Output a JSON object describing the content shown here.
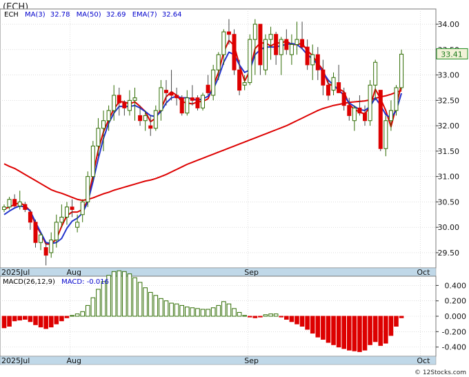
{
  "window_title": "(ECH)",
  "watermark": "© 12Stocks.com",
  "colors": {
    "up": "#2e6b00",
    "down": "#dd0000",
    "ma_short": "#dd0000",
    "ma_long": "#0000cc",
    "ema": "#2233cc",
    "band": "#c0d8e8",
    "grid": "#c8c8c8",
    "price_box_bg": "#f2f2d8",
    "price_box_border": "#1a8a1a"
  },
  "chart_data": [
    {
      "type": "candlestick",
      "ticker": "ECH",
      "legend": [
        {
          "label": "ECH",
          "value": "",
          "color": "#000000"
        },
        {
          "label": "MA(3)",
          "value": "32.78",
          "color": "#dd0000"
        },
        {
          "label": "MA(50)",
          "value": "32.69",
          "color": "#0000cc"
        },
        {
          "label": "EMA(7)",
          "value": "32.64",
          "color": "#2233cc"
        }
      ],
      "last_price": "33.41",
      "ylim": [
        29.2,
        34.3
      ],
      "y_ticks": [
        "29.50",
        "30.00",
        "30.50",
        "31.00",
        "31.50",
        "32.00",
        "32.50",
        "33.00",
        "33.50",
        "34.00"
      ],
      "x_labels": [
        "2025Jul",
        "Aug",
        "Sep",
        "Oct"
      ],
      "x_label_index": [
        0,
        13,
        47,
        80
      ],
      "candles": [
        [
          30.35,
          30.45,
          30.3,
          30.4
        ],
        [
          30.4,
          30.6,
          30.35,
          30.55
        ],
        [
          30.55,
          30.65,
          30.4,
          30.42
        ],
        [
          30.42,
          30.72,
          30.35,
          30.5
        ],
        [
          30.45,
          30.5,
          30.3,
          30.35
        ],
        [
          30.3,
          30.35,
          29.95,
          30.1
        ],
        [
          30.1,
          30.15,
          29.6,
          29.7
        ],
        [
          29.7,
          29.9,
          29.55,
          29.85
        ],
        [
          29.6,
          29.7,
          29.25,
          29.45
        ],
        [
          29.5,
          29.9,
          29.4,
          29.75
        ],
        [
          29.75,
          30.25,
          29.6,
          30.1
        ],
        [
          30.1,
          30.45,
          30.0,
          30.2
        ],
        [
          30.2,
          30.5,
          30.05,
          30.4
        ],
        [
          30.4,
          30.55,
          30.2,
          30.35
        ],
        [
          30.0,
          30.25,
          29.9,
          30.1
        ],
        [
          30.25,
          30.55,
          30.1,
          30.5
        ],
        [
          30.5,
          31.1,
          30.4,
          31.0
        ],
        [
          31.0,
          31.7,
          30.9,
          31.6
        ],
        [
          31.6,
          32.15,
          31.4,
          31.95
        ],
        [
          31.95,
          32.3,
          31.5,
          32.1
        ],
        [
          32.1,
          32.4,
          31.9,
          32.3
        ],
        [
          32.3,
          32.8,
          32.1,
          32.6
        ],
        [
          32.6,
          32.75,
          32.2,
          32.45
        ],
        [
          32.45,
          32.5,
          32.2,
          32.35
        ],
        [
          32.3,
          32.7,
          32.2,
          32.5
        ],
        [
          32.5,
          32.75,
          32.1,
          32.55
        ],
        [
          32.2,
          32.4,
          32.0,
          32.1
        ],
        [
          32.1,
          32.3,
          31.9,
          32.2
        ],
        [
          32.0,
          32.2,
          31.8,
          31.95
        ],
        [
          31.95,
          32.4,
          31.9,
          32.3
        ],
        [
          32.3,
          32.9,
          32.1,
          32.75
        ],
        [
          32.7,
          32.9,
          32.4,
          32.65
        ],
        [
          32.65,
          33.1,
          32.5,
          32.6
        ],
        [
          32.6,
          32.75,
          32.4,
          32.55
        ],
        [
          32.55,
          32.6,
          32.2,
          32.25
        ],
        [
          32.25,
          32.7,
          32.2,
          32.55
        ],
        [
          32.55,
          32.8,
          32.4,
          32.5
        ],
        [
          32.55,
          32.6,
          32.3,
          32.35
        ],
        [
          32.35,
          32.65,
          32.3,
          32.6
        ],
        [
          32.8,
          33.0,
          32.6,
          32.65
        ],
        [
          32.6,
          33.2,
          32.5,
          33.1
        ],
        [
          33.1,
          33.45,
          32.9,
          33.4
        ],
        [
          33.4,
          33.9,
          33.2,
          33.85
        ],
        [
          33.85,
          34.1,
          33.6,
          33.8
        ],
        [
          33.8,
          33.9,
          33.0,
          33.1
        ],
        [
          33.1,
          33.3,
          32.6,
          32.7
        ],
        [
          32.8,
          33.0,
          32.7,
          32.85
        ],
        [
          32.85,
          33.8,
          32.8,
          33.7
        ],
        [
          33.7,
          34.1,
          33.0,
          34.0
        ],
        [
          34.0,
          34.0,
          33.0,
          33.2
        ],
        [
          33.1,
          33.8,
          33.0,
          33.7
        ],
        [
          33.7,
          33.95,
          33.3,
          33.8
        ],
        [
          33.8,
          33.85,
          33.2,
          33.4
        ],
        [
          33.4,
          33.75,
          33.0,
          33.7
        ],
        [
          33.7,
          33.9,
          33.4,
          33.5
        ],
        [
          33.4,
          33.8,
          33.2,
          33.6
        ],
        [
          33.6,
          34.05,
          33.4,
          33.7
        ],
        [
          33.7,
          34.05,
          33.5,
          33.55
        ],
        [
          33.55,
          33.7,
          33.1,
          33.2
        ],
        [
          33.2,
          33.6,
          32.9,
          33.4
        ],
        [
          33.4,
          33.55,
          32.9,
          33.1
        ],
        [
          33.1,
          33.3,
          32.6,
          32.8
        ],
        [
          32.8,
          32.9,
          32.5,
          32.6
        ],
        [
          32.7,
          33.05,
          32.6,
          32.95
        ],
        [
          32.85,
          33.2,
          32.7,
          32.65
        ],
        [
          32.65,
          32.75,
          32.3,
          32.4
        ],
        [
          32.4,
          32.55,
          32.1,
          32.2
        ],
        [
          32.1,
          32.4,
          31.9,
          32.35
        ],
        [
          32.35,
          32.6,
          32.2,
          32.25
        ],
        [
          32.25,
          32.4,
          32.0,
          32.1
        ],
        [
          32.1,
          32.9,
          32.0,
          32.8
        ],
        [
          32.8,
          33.3,
          32.5,
          33.25
        ],
        [
          32.7,
          32.7,
          31.5,
          31.55
        ],
        [
          31.55,
          32.2,
          31.4,
          32.1
        ],
        [
          32.1,
          32.5,
          31.9,
          32.3
        ],
        [
          32.3,
          32.8,
          32.2,
          32.75
        ],
        [
          32.75,
          33.5,
          32.7,
          33.41
        ]
      ],
      "ma_fast": [
        30.36,
        30.4,
        30.45,
        30.48,
        30.43,
        30.32,
        30.05,
        29.88,
        29.67,
        29.67,
        29.77,
        30.02,
        30.23,
        30.3,
        30.3,
        30.35,
        30.53,
        31.03,
        31.52,
        31.88,
        32.12,
        32.33,
        32.47,
        32.47,
        32.43,
        32.47,
        32.38,
        32.28,
        32.08,
        32.15,
        32.33,
        32.57,
        32.67,
        32.6,
        32.47,
        32.45,
        32.43,
        32.47,
        32.48,
        32.53,
        32.78,
        33.05,
        33.45,
        33.68,
        33.58,
        33.2,
        32.88,
        33.08,
        33.52,
        33.63,
        33.63,
        33.57,
        33.63,
        33.63,
        33.67,
        33.6,
        33.6,
        33.62,
        33.48,
        33.38,
        33.23,
        33.1,
        32.83,
        32.78,
        32.73,
        32.67,
        32.42,
        32.32,
        32.27,
        32.23,
        32.38,
        32.72,
        32.53,
        32.3,
        31.98,
        32.38,
        32.82
      ],
      "ma_slow": [
        31.25,
        31.2,
        31.16,
        31.1,
        31.04,
        30.98,
        30.92,
        30.86,
        30.8,
        30.74,
        30.7,
        30.67,
        30.63,
        30.59,
        30.55,
        30.53,
        30.55,
        30.58,
        30.62,
        30.66,
        30.69,
        30.73,
        30.76,
        30.79,
        30.82,
        30.85,
        30.88,
        30.91,
        30.93,
        30.96,
        31.0,
        31.04,
        31.09,
        31.14,
        31.19,
        31.24,
        31.28,
        31.32,
        31.36,
        31.4,
        31.44,
        31.48,
        31.52,
        31.56,
        31.6,
        31.64,
        31.68,
        31.72,
        31.76,
        31.8,
        31.84,
        31.88,
        31.92,
        31.96,
        32.0,
        32.05,
        32.1,
        32.15,
        32.2,
        32.25,
        32.3,
        32.34,
        32.37,
        32.4,
        32.42,
        32.44,
        32.46,
        32.47,
        32.48,
        32.49,
        32.51,
        32.54,
        32.57,
        32.59,
        32.62,
        32.66,
        32.69
      ],
      "ema": [
        30.25,
        30.32,
        30.38,
        30.42,
        30.4,
        30.32,
        30.1,
        29.9,
        29.7,
        29.68,
        29.7,
        29.78,
        29.98,
        30.12,
        30.18,
        30.28,
        30.5,
        30.9,
        31.35,
        31.75,
        32.05,
        32.25,
        32.38,
        32.38,
        32.38,
        32.4,
        32.35,
        32.28,
        32.2,
        32.18,
        32.28,
        32.45,
        32.55,
        32.58,
        32.55,
        32.55,
        32.53,
        32.5,
        32.53,
        32.58,
        32.72,
        32.95,
        33.25,
        33.45,
        33.4,
        33.2,
        33.05,
        33.1,
        33.4,
        33.5,
        33.55,
        33.55,
        33.55,
        33.58,
        33.6,
        33.62,
        33.6,
        33.52,
        33.4,
        33.32,
        33.2,
        33.05,
        32.9,
        32.8,
        32.7,
        32.6,
        32.45,
        32.38,
        32.32,
        32.3,
        32.38,
        32.55,
        32.4,
        32.22,
        32.15,
        32.3,
        32.64
      ]
    },
    {
      "type": "bar",
      "title": "MACD(26,12,9)",
      "value_label": "MACD:",
      "value": "-0.016",
      "ylim": [
        -0.52,
        0.52
      ],
      "y_ticks": [
        "0.400",
        "0.200",
        "0.000",
        "-0.200",
        "-0.400"
      ],
      "x_labels": [
        "2025Jul",
        "Aug",
        "Sep",
        "Oct"
      ],
      "values": [
        -0.15,
        -0.13,
        -0.06,
        -0.05,
        -0.04,
        -0.07,
        -0.11,
        -0.14,
        -0.16,
        -0.14,
        -0.1,
        -0.06,
        -0.02,
        0.01,
        0.03,
        0.06,
        0.14,
        0.24,
        0.35,
        0.45,
        0.53,
        0.58,
        0.59,
        0.58,
        0.55,
        0.5,
        0.44,
        0.37,
        0.31,
        0.27,
        0.23,
        0.2,
        0.17,
        0.16,
        0.14,
        0.12,
        0.11,
        0.1,
        0.09,
        0.09,
        0.11,
        0.14,
        0.19,
        0.16,
        0.1,
        0.05,
        0.01,
        -0.01,
        -0.02,
        -0.01,
        0.02,
        0.03,
        0.03,
        -0.01,
        -0.04,
        -0.07,
        -0.1,
        -0.13,
        -0.17,
        -0.22,
        -0.27,
        -0.3,
        -0.34,
        -0.37,
        -0.4,
        -0.42,
        -0.44,
        -0.45,
        -0.46,
        -0.44,
        -0.37,
        -0.33,
        -0.38,
        -0.35,
        -0.25,
        -0.13,
        -0.02
      ]
    }
  ]
}
